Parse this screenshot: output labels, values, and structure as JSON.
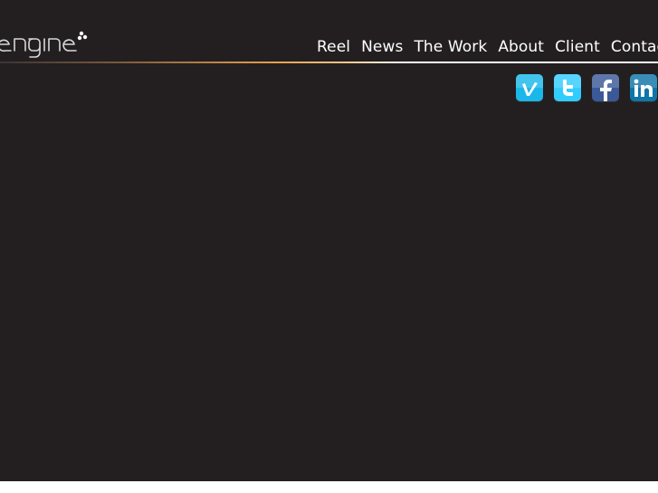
{
  "brand": {
    "logo_text": "engine"
  },
  "nav": {
    "items": [
      {
        "label": "Reel"
      },
      {
        "label": "News"
      },
      {
        "label": "The Work"
      },
      {
        "label": "About"
      },
      {
        "label": "Client"
      },
      {
        "label": "Contact"
      }
    ]
  },
  "social": {
    "icons": [
      {
        "name": "vimeo-icon",
        "color": "#1ab7ea"
      },
      {
        "name": "twitter-icon",
        "color": "#33ccff"
      },
      {
        "name": "facebook-icon",
        "color": "#3b5998"
      },
      {
        "name": "linkedin-icon",
        "color": "#0e76a8"
      }
    ]
  },
  "colors": {
    "background": "#231f20",
    "nav_text": "#ffffff",
    "rule_accent": "#e8a050"
  }
}
